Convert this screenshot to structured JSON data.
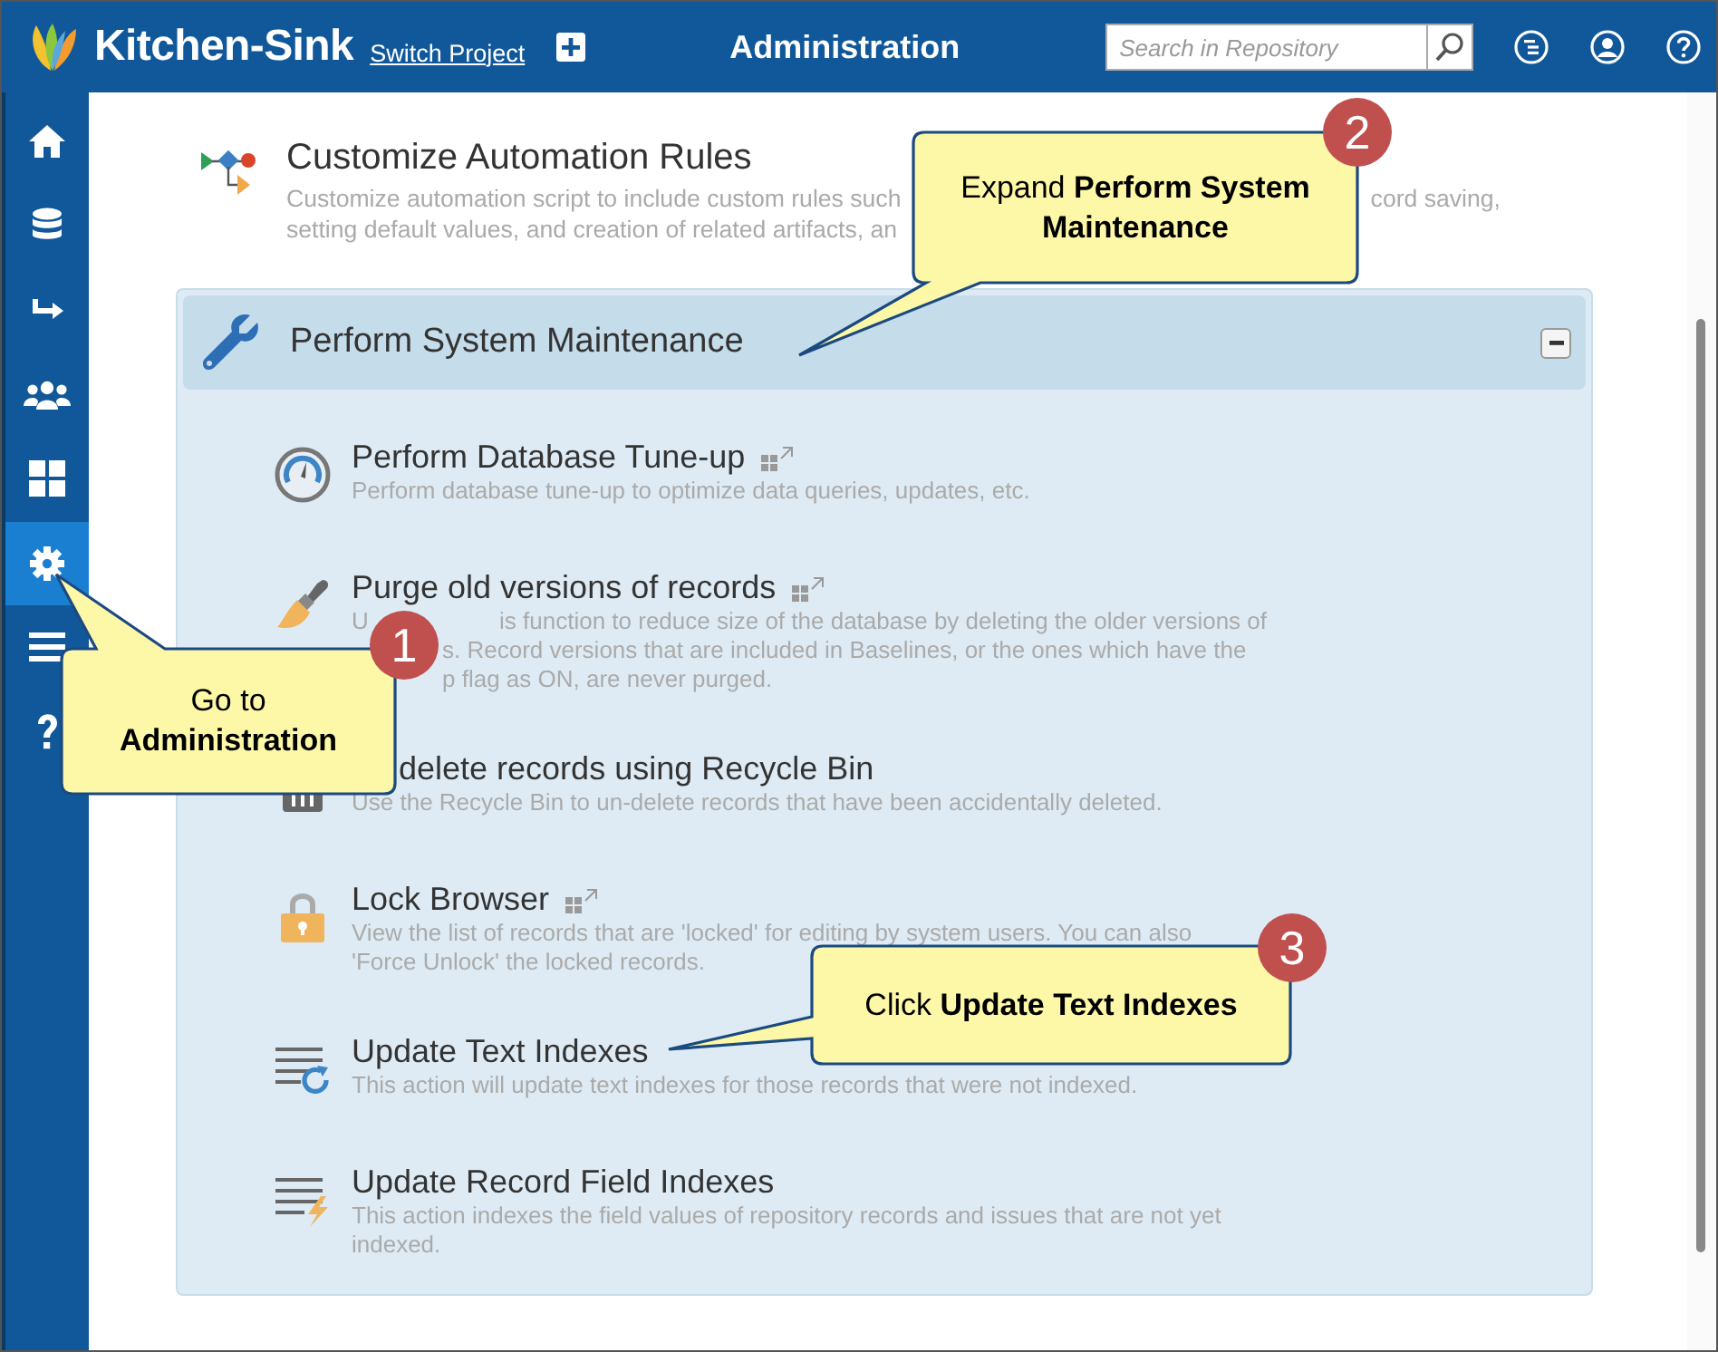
{
  "header": {
    "app_name": "Kitchen-Sink",
    "switch_link": "Switch Project",
    "title": "Administration",
    "search": {
      "placeholder": "Search in Repository"
    }
  },
  "sidebar": {
    "items": [
      {
        "kind": "home",
        "selected": false
      },
      {
        "kind": "database",
        "selected": false
      },
      {
        "kind": "redirect",
        "selected": false
      },
      {
        "kind": "users",
        "selected": false
      },
      {
        "kind": "dashboard",
        "selected": false
      },
      {
        "kind": "settings",
        "selected": true
      },
      {
        "kind": "menu",
        "selected": false
      },
      {
        "kind": "help",
        "selected": false
      }
    ]
  },
  "top_item": {
    "title": "Customize Automation Rules",
    "lines": [
      {
        "segments": [
          "Customize automation script to include custom rules such",
          "cord saving,"
        ],
        "covered_start": false
      },
      {
        "segments": [
          "setting default values, and creation of related artifacts, an"
        ],
        "covered_start": false
      }
    ]
  },
  "panel": {
    "title": "Perform System Maintenance",
    "expanded": true,
    "items": [
      {
        "kind": "tune",
        "title": "Perform Database Tune-up",
        "popout": true,
        "title_covered_start": false,
        "lines": [
          {
            "segments": [
              "Perform database tune-up to optimize data queries, updates, etc."
            ],
            "covered_start": false
          }
        ]
      },
      {
        "kind": "purge",
        "title": "Purge old versions of records",
        "popout": true,
        "title_covered_start": false,
        "lines": [
          {
            "segments": [
              "U",
              "is function to reduce size of the database by deleting the older versions of"
            ],
            "covered_start": false
          },
          {
            "segments": [
              "s. Record versions that are included in Baselines, or the ones which have the"
            ],
            "covered_start": true
          },
          {
            "segments": [
              "p flag as ON, are never purged."
            ],
            "covered_start": true
          }
        ]
      },
      {
        "kind": "recycle",
        "title": "delete records using Recycle Bin",
        "popout": false,
        "title_covered_start": true,
        "lines": [
          {
            "segments": [
              "Use the Recycle Bin to un-delete records that have been accidentally deleted."
            ],
            "covered_start": false
          }
        ]
      },
      {
        "kind": "lock",
        "title": "Lock Browser",
        "popout": true,
        "title_covered_start": false,
        "lines": [
          {
            "segments": [
              "View the list of records that are 'locked' for editing by system users. You can also"
            ],
            "covered_start": false
          },
          {
            "segments": [
              "'Force Unlock' the locked records."
            ],
            "covered_start": false
          }
        ]
      },
      {
        "kind": "text-index",
        "title": "Update Text Indexes",
        "popout": false,
        "title_covered_start": false,
        "lines": [
          {
            "segments": [
              "This action will update text indexes for those records that were not indexed."
            ],
            "covered_start": false
          }
        ]
      },
      {
        "kind": "field-index",
        "title": "Update Record Field Indexes",
        "popout": false,
        "title_covered_start": false,
        "lines": [
          {
            "segments": [
              "This action indexes the field values of repository records and issues that are not yet"
            ],
            "covered_start": false
          },
          {
            "segments": [
              "indexed."
            ],
            "covered_start": false
          }
        ]
      }
    ]
  },
  "callouts": [
    {
      "step": "2",
      "text": "Expand **Perform System Maintenance**"
    },
    {
      "step": "1",
      "text": "Go to **Administration**"
    },
    {
      "step": "3",
      "text": "Click **Update Text Indexes**"
    }
  ]
}
